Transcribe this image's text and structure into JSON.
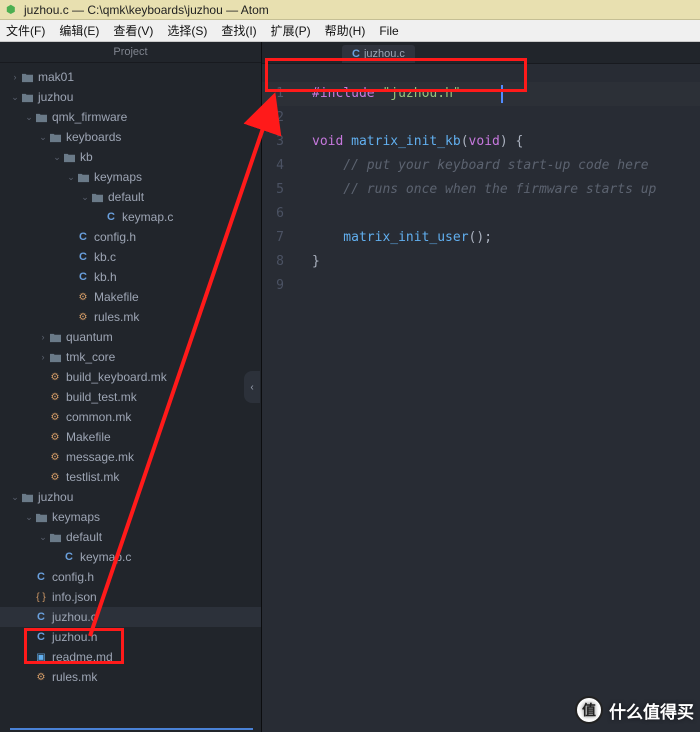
{
  "window": {
    "title": "juzhou.c — C:\\qmk\\keyboards\\juzhou — Atom"
  },
  "menu": {
    "items": [
      "文件(F)",
      "编辑(E)",
      "查看(V)",
      "选择(S)",
      "查找(I)",
      "扩展(P)",
      "帮助(H)",
      "File"
    ]
  },
  "sidebar": {
    "title": "Project",
    "tree": [
      {
        "indent": 0,
        "chev": "›",
        "type": "folder",
        "label": "mak01"
      },
      {
        "indent": 0,
        "chev": "⌄",
        "type": "folder",
        "label": "juzhou"
      },
      {
        "indent": 1,
        "chev": "⌄",
        "type": "folder",
        "label": "qmk_firmware"
      },
      {
        "indent": 2,
        "chev": "⌄",
        "type": "folder",
        "label": "keyboards"
      },
      {
        "indent": 3,
        "chev": "⌄",
        "type": "folder",
        "label": "kb"
      },
      {
        "indent": 4,
        "chev": "⌄",
        "type": "folder",
        "label": "keymaps"
      },
      {
        "indent": 5,
        "chev": "⌄",
        "type": "folder",
        "label": "default"
      },
      {
        "indent": 6,
        "chev": "",
        "type": "c",
        "label": "keymap.c"
      },
      {
        "indent": 4,
        "chev": "",
        "type": "c",
        "label": "config.h"
      },
      {
        "indent": 4,
        "chev": "",
        "type": "c",
        "label": "kb.c"
      },
      {
        "indent": 4,
        "chev": "",
        "type": "c",
        "label": "kb.h"
      },
      {
        "indent": 4,
        "chev": "",
        "type": "mk",
        "label": "Makefile"
      },
      {
        "indent": 4,
        "chev": "",
        "type": "mk",
        "label": "rules.mk"
      },
      {
        "indent": 2,
        "chev": "›",
        "type": "folder",
        "label": "quantum"
      },
      {
        "indent": 2,
        "chev": "›",
        "type": "folder",
        "label": "tmk_core"
      },
      {
        "indent": 2,
        "chev": "",
        "type": "mk",
        "label": "build_keyboard.mk"
      },
      {
        "indent": 2,
        "chev": "",
        "type": "mk",
        "label": "build_test.mk"
      },
      {
        "indent": 2,
        "chev": "",
        "type": "mk",
        "label": "common.mk"
      },
      {
        "indent": 2,
        "chev": "",
        "type": "mk",
        "label": "Makefile"
      },
      {
        "indent": 2,
        "chev": "",
        "type": "mk",
        "label": "message.mk"
      },
      {
        "indent": 2,
        "chev": "",
        "type": "mk",
        "label": "testlist.mk"
      },
      {
        "indent": 0,
        "chev": "⌄",
        "type": "folder",
        "label": "juzhou"
      },
      {
        "indent": 1,
        "chev": "⌄",
        "type": "folder",
        "label": "keymaps"
      },
      {
        "indent": 2,
        "chev": "⌄",
        "type": "folder",
        "label": "default"
      },
      {
        "indent": 3,
        "chev": "",
        "type": "c",
        "label": "keymap.c"
      },
      {
        "indent": 1,
        "chev": "",
        "type": "c",
        "label": "config.h"
      },
      {
        "indent": 1,
        "chev": "",
        "type": "json",
        "label": "info.json"
      },
      {
        "indent": 1,
        "chev": "",
        "type": "c",
        "label": "juzhou.c",
        "selected": true
      },
      {
        "indent": 1,
        "chev": "",
        "type": "c",
        "label": "juzhou.h"
      },
      {
        "indent": 1,
        "chev": "",
        "type": "md",
        "label": "readme.md"
      },
      {
        "indent": 1,
        "chev": "",
        "type": "mk",
        "label": "rules.mk"
      }
    ]
  },
  "editor": {
    "tab_label": "juzhou.c",
    "line_numbers": [
      "1",
      "2",
      "3",
      "4",
      "5",
      "6",
      "7",
      "8",
      "9"
    ],
    "code": {
      "l1_pre": "#include",
      "l1_str": " \"juzhou.h\"",
      "l3_kw": "void",
      "l3_fn": " matrix_init_kb",
      "l3_rest": "(",
      "l3_kw2": "void",
      "l3_rest2": ") {",
      "l4_com": "    // put your keyboard start-up code here",
      "l5_com": "    // runs once when the firmware starts up",
      "l7_fn": "    matrix_init_user",
      "l7_rest": "();",
      "l8": "}"
    }
  },
  "watermark": {
    "badge": "值",
    "text": "什么值得买"
  }
}
